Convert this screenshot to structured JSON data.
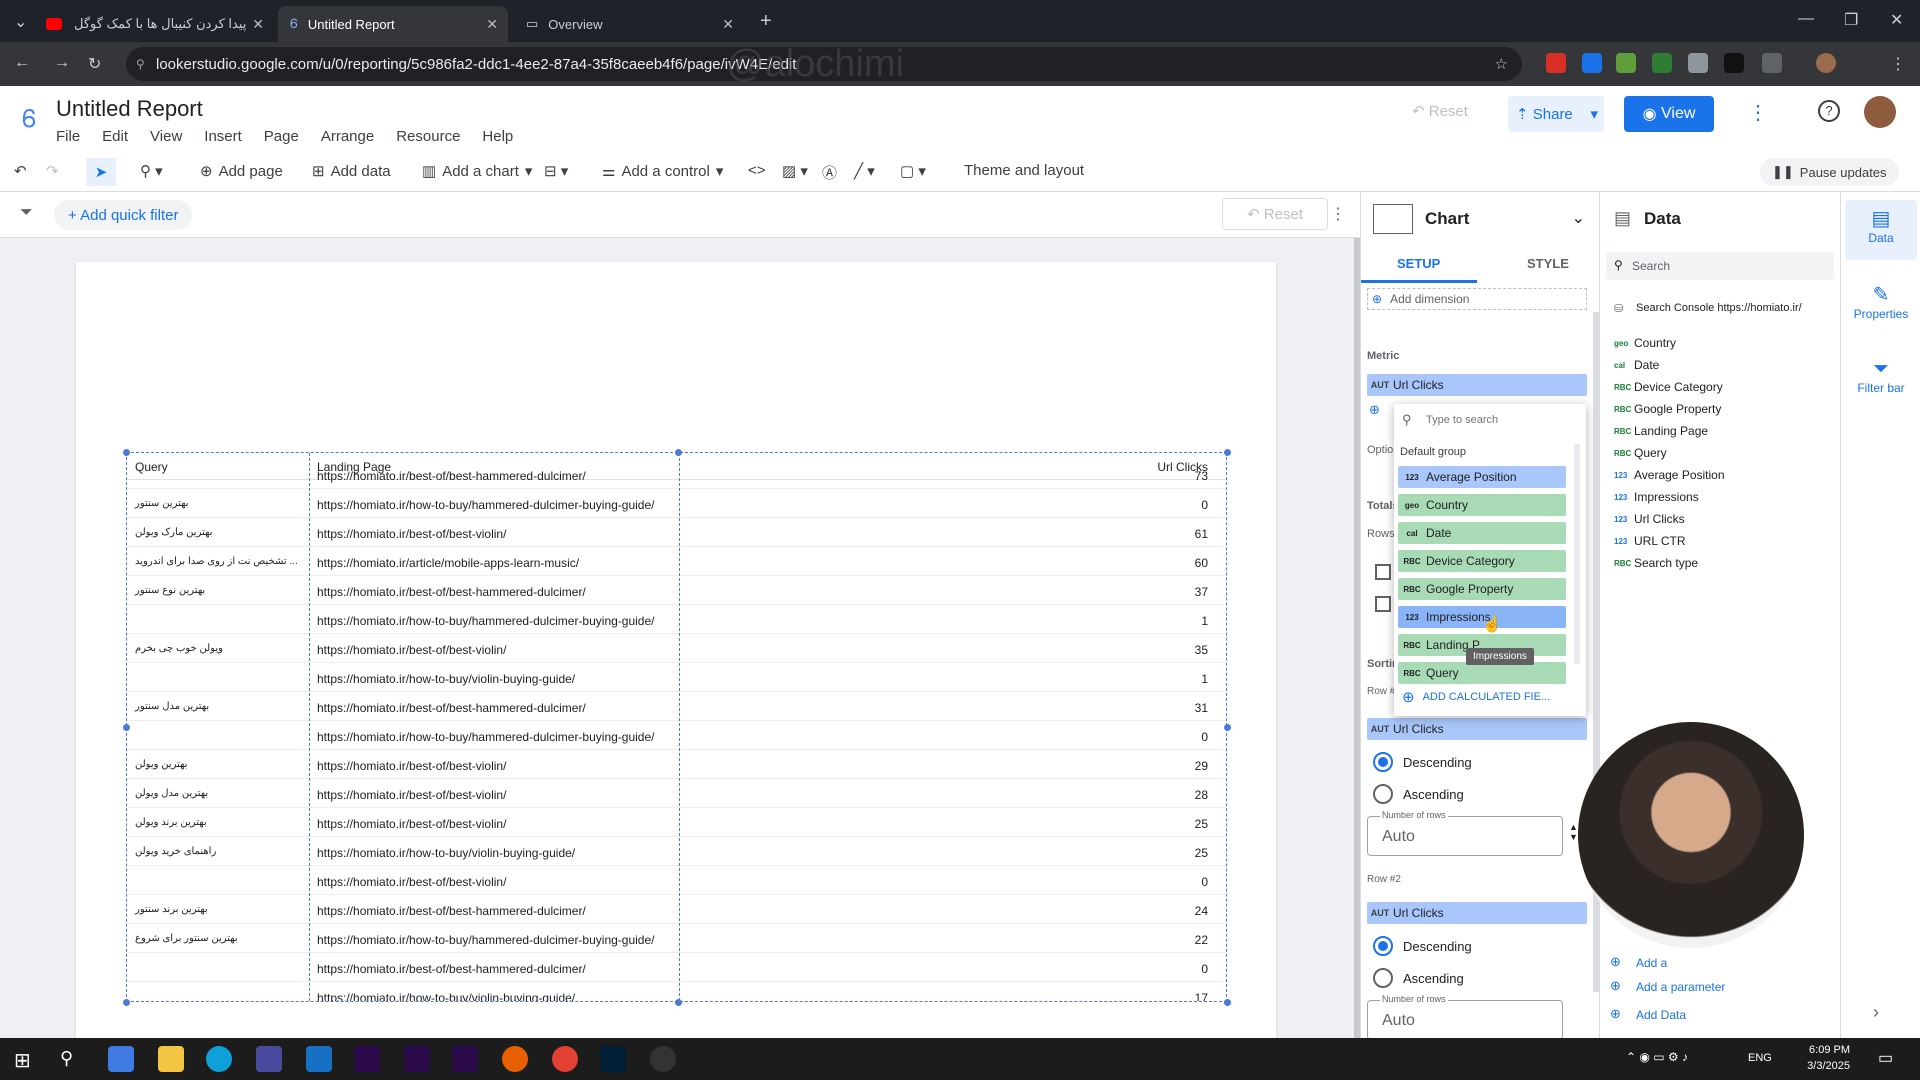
{
  "browser": {
    "tabs": [
      {
        "label": "پیدا کردن کنیبال ها با کمک گوگل",
        "active": false
      },
      {
        "label": "Untitled Report",
        "active": true
      },
      {
        "label": "Overview",
        "active": false
      }
    ],
    "url": "lookerstudio.google.com/u/0/reporting/5c986fa2-ddc1-4ee2-87a4-35f8caeeb4f6/page/ivW4E/edit"
  },
  "app": {
    "title": "Untitled Report",
    "menu": [
      "File",
      "Edit",
      "View",
      "Insert",
      "Page",
      "Arrange",
      "Resource",
      "Help"
    ],
    "reset_label": "Reset",
    "share_label": "Share",
    "view_label": "View"
  },
  "toolbar": {
    "add_page": "Add page",
    "add_data": "Add data",
    "add_chart": "Add a chart",
    "add_control": "Add a control",
    "theme": "Theme and layout",
    "pause": "Pause updates"
  },
  "filterbar": {
    "add_filter": "+ Add quick filter",
    "reset": "Reset"
  },
  "table": {
    "headers": [
      "Query",
      "Landing Page",
      "Url Clicks"
    ],
    "rows": [
      {
        "query": "",
        "page": "https://homiato.ir/best-of/best-hammered-dulcimer/",
        "clicks": "73"
      },
      {
        "query": "بهترین سنتور",
        "page": "https://homiato.ir/how-to-buy/hammered-dulcimer-buying-guide/",
        "clicks": "0"
      },
      {
        "query": "بهترین مارک ویولن",
        "page": "https://homiato.ir/best-of/best-violin/",
        "clicks": "61"
      },
      {
        "query": "... تشخیص نت از روی صدا برای اندروید",
        "page": "https://homiato.ir/article/mobile-apps-learn-music/",
        "clicks": "60"
      },
      {
        "query": "بهترین نوع سنتور",
        "page": "https://homiato.ir/best-of/best-hammered-dulcimer/",
        "clicks": "37"
      },
      {
        "query": "",
        "page": "https://homiato.ir/how-to-buy/hammered-dulcimer-buying-guide/",
        "clicks": "1"
      },
      {
        "query": "ویولن خوب چی بخرم",
        "page": "https://homiato.ir/best-of/best-violin/",
        "clicks": "35"
      },
      {
        "query": "",
        "page": "https://homiato.ir/how-to-buy/violin-buying-guide/",
        "clicks": "1"
      },
      {
        "query": "بهترین مدل سنتور",
        "page": "https://homiato.ir/best-of/best-hammered-dulcimer/",
        "clicks": "31"
      },
      {
        "query": "",
        "page": "https://homiato.ir/how-to-buy/hammered-dulcimer-buying-guide/",
        "clicks": "0"
      },
      {
        "query": "بهترین ویولن",
        "page": "https://homiato.ir/best-of/best-violin/",
        "clicks": "29"
      },
      {
        "query": "بهترین مدل ویولن",
        "page": "https://homiato.ir/best-of/best-violin/",
        "clicks": "28"
      },
      {
        "query": "بهترین برند ویولن",
        "page": "https://homiato.ir/best-of/best-violin/",
        "clicks": "25"
      },
      {
        "query": "راهنمای خرید ویولن",
        "page": "https://homiato.ir/how-to-buy/violin-buying-guide/",
        "clicks": "25"
      },
      {
        "query": "",
        "page": "https://homiato.ir/best-of/best-violin/",
        "clicks": "0"
      },
      {
        "query": "بهترین برند سنتور",
        "page": "https://homiato.ir/best-of/best-hammered-dulcimer/",
        "clicks": "24"
      },
      {
        "query": "بهترین سنتور برای شروع",
        "page": "https://homiato.ir/how-to-buy/hammered-dulcimer-buying-guide/",
        "clicks": "22"
      },
      {
        "query": "",
        "page": "https://homiato.ir/best-of/best-hammered-dulcimer/",
        "clicks": "0"
      },
      {
        "query": "",
        "page": "https://homiato.ir/how-to-buy/violin-buying-guide/",
        "clicks": "17"
      }
    ]
  },
  "chart_panel": {
    "title": "Chart",
    "tab_setup": "SETUP",
    "tab_style": "STYLE",
    "add_dimension": "Add dimension",
    "metric_label": "Metric",
    "metric_chip": "Url Clicks",
    "metric_type": "AUT",
    "side_labels": [
      "Optio",
      "Totals",
      "Rows",
      "Sortin",
      "Row #"
    ],
    "sort1_field": "Url Clicks",
    "descending": "Descending",
    "ascending": "Ascending",
    "number_of_rows": "Number of rows",
    "rows_value": "Auto",
    "row2_label": "Row #2",
    "sort2_field": "Url Clicks"
  },
  "dropdown": {
    "placeholder": "Type to search",
    "group": "Default group",
    "items": [
      {
        "type": "123",
        "label": "Average Position",
        "color": "#a9c7fa"
      },
      {
        "type": "geo",
        "label": "Country",
        "color": "#a8dab5"
      },
      {
        "type": "cal",
        "label": "Date",
        "color": "#a8dab5"
      },
      {
        "type": "RBC",
        "label": "Device Category",
        "color": "#a8dab5"
      },
      {
        "type": "RBC",
        "label": "Google Property",
        "color": "#a8dab5"
      },
      {
        "type": "123",
        "label": "Impressions",
        "color": "#8ab4f8"
      },
      {
        "type": "RBC",
        "label": "Landing P",
        "color": "#a8dab5"
      },
      {
        "type": "RBC",
        "label": "Query",
        "color": "#a8dab5"
      }
    ],
    "tooltip": "Impressions",
    "add_calc": "ADD CALCULATED FIE..."
  },
  "data_panel": {
    "title": "Data",
    "search": "Search",
    "source": "Search Console https://homiato.ir/",
    "fields": [
      {
        "type": "geo",
        "label": "Country"
      },
      {
        "type": "cal",
        "label": "Date"
      },
      {
        "type": "RBC",
        "label": "Device Category"
      },
      {
        "type": "RBC",
        "label": "Google Property"
      },
      {
        "type": "RBC",
        "label": "Landing Page"
      },
      {
        "type": "RBC",
        "label": "Query"
      },
      {
        "type": "123",
        "label": "Average Position"
      },
      {
        "type": "123",
        "label": "Impressions"
      },
      {
        "type": "123",
        "label": "Url Clicks"
      },
      {
        "type": "123",
        "label": "URL CTR"
      },
      {
        "type": "RBC",
        "label": "Search type"
      }
    ],
    "add_field": "Add a",
    "add_parameter": "Add a parameter",
    "add_data": "Add Data"
  },
  "side_tabs": [
    "Data",
    "Properties",
    "Filter bar"
  ],
  "watermark": "@alochimi",
  "taskbar": {
    "lang": "ENG",
    "time": "6:09 PM",
    "date": "3/3/2025"
  }
}
